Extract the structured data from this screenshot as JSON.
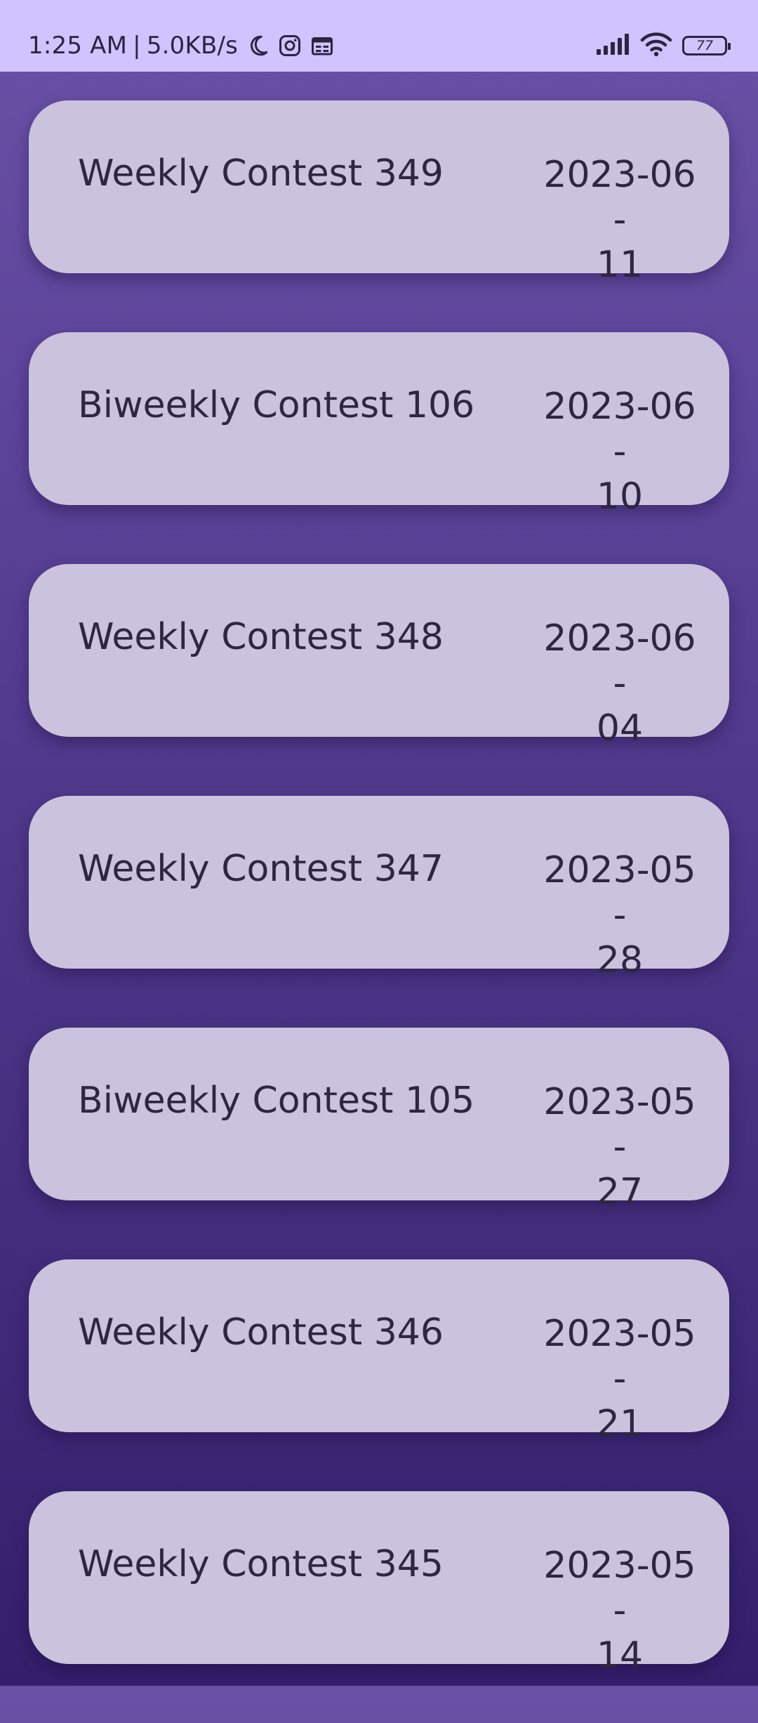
{
  "status_bar": {
    "time": "1:25 AM",
    "separator": "|",
    "network_speed": "5.0KB/s",
    "battery_level": "77",
    "icons": [
      "moon-icon",
      "instagram-icon",
      "calendar-icon",
      "signal-icon",
      "wifi-icon",
      "battery-icon"
    ]
  },
  "contests": [
    {
      "title": "Weekly Contest 349",
      "date_line1": "2023-06-",
      "date_line2": "11"
    },
    {
      "title": "Biweekly Contest 106",
      "date_line1": "2023-06-",
      "date_line2": "10"
    },
    {
      "title": "Weekly Contest 348",
      "date_line1": "2023-06-",
      "date_line2": "04"
    },
    {
      "title": "Weekly Contest 347",
      "date_line1": "2023-05-",
      "date_line2": "28"
    },
    {
      "title": "Biweekly Contest 105",
      "date_line1": "2023-05-",
      "date_line2": "27"
    },
    {
      "title": "Weekly Contest 346",
      "date_line1": "2023-05-",
      "date_line2": "21"
    },
    {
      "title": "Weekly Contest 345",
      "date_line1": "2023-05-",
      "date_line2": "14"
    }
  ],
  "colors": {
    "status_bar_bg": "#d1c3ff",
    "card_bg": "#cbc2dd",
    "text": "#2e2740",
    "background_top": "#6a51a6",
    "background_bottom": "#341f6c"
  }
}
